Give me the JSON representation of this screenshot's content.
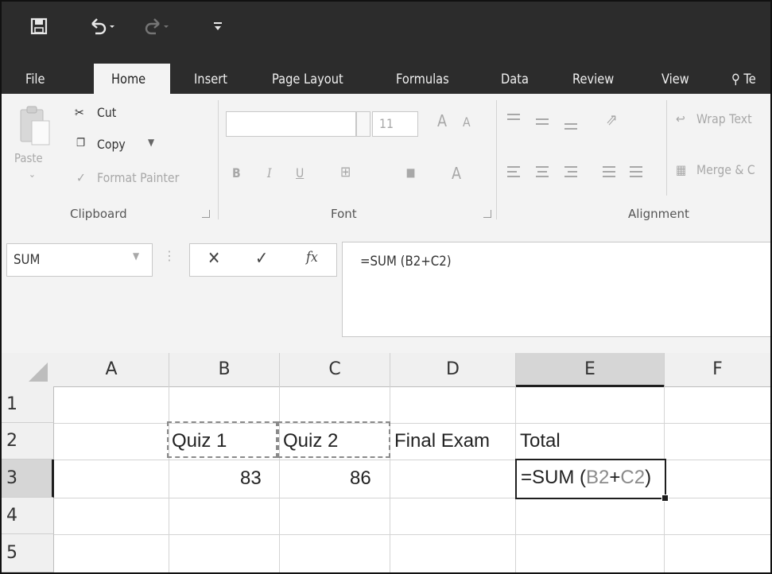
{
  "quick_access": {
    "save_icon": "save-icon",
    "undo_icon": "undo-icon",
    "redo_icon": "redo-icon",
    "customize_icon": "customize-qat-icon"
  },
  "tabs": [
    "File",
    "Home",
    "Insert",
    "Page Layout",
    "Formulas",
    "Data",
    "Review",
    "View"
  ],
  "tell_me": {
    "icon": "lightbulb-icon",
    "label": "Te"
  },
  "clipboard": {
    "paste": "Paste",
    "cut": "Cut",
    "copy": "Copy",
    "format_painter": "Format Painter",
    "group_label": "Clipboard"
  },
  "font": {
    "font_name": "",
    "font_size": "11",
    "bold": "B",
    "italic": "I",
    "underline": "U",
    "font_color": "A",
    "grow": "A",
    "shrink": "A",
    "group_label": "Font"
  },
  "alignment": {
    "wrap_text": "Wrap Text",
    "merge": "Merge & C",
    "group_label": "Alignment"
  },
  "formula_bar": {
    "name_box": "SUM",
    "cancel": "✕",
    "enter": "✓",
    "fx": "fx",
    "formula": "=SUM (B2+C2)"
  },
  "columns": [
    "A",
    "B",
    "C",
    "D",
    "E",
    "F"
  ],
  "rows": [
    "1",
    "2",
    "3",
    "4",
    "5"
  ],
  "cells": {
    "B2": "Quiz 1",
    "C2": "Quiz 2",
    "D2": "Final Exam",
    "E2": "Total",
    "B3": "83",
    "C3": "86",
    "E3_prefix": "=SUM (",
    "E3_ref1": "B2",
    "E3_plus": "+",
    "E3_ref2": "C2",
    "E3_suffix": ")"
  },
  "colors": {
    "title_bar": "#2c2c2c",
    "ribbon": "#f3f3f3",
    "ref_highlight": "#888888"
  }
}
